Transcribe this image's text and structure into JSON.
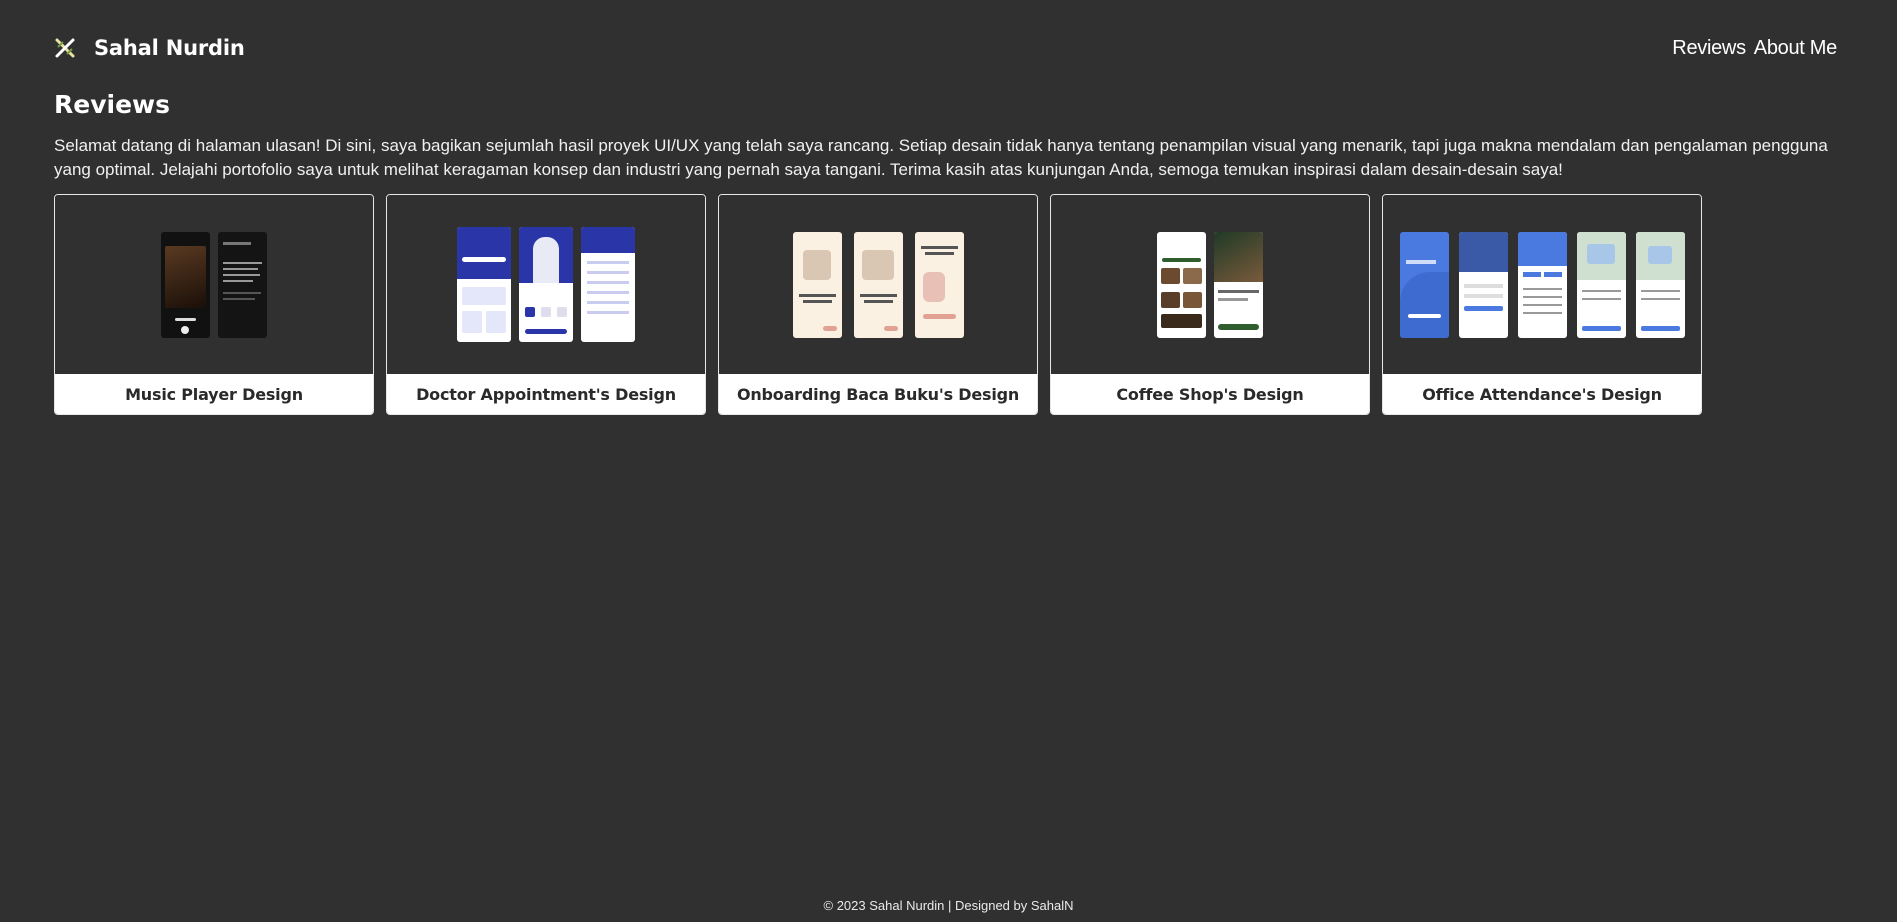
{
  "header": {
    "brand_name": "Sahal Nurdin",
    "logo_icon": "crossed-swords-logo-icon",
    "nav": [
      {
        "label": "Reviews"
      },
      {
        "label": "About Me"
      }
    ]
  },
  "page": {
    "title": "Reviews",
    "intro": "Selamat datang di halaman ulasan! Di sini, saya bagikan sejumlah hasil proyek UI/UX yang telah saya rancang. Setiap desain tidak hanya tentang penampilan visual yang menarik, tapi juga makna mendalam dan pengalaman pengguna yang optimal. Jelajahi portofolio saya untuk melihat keragaman konsep dan industri yang pernah saya tangani. Terima kasih atas kunjungan Anda, semoga temukan inspirasi dalam desain-desain saya!"
  },
  "cards": [
    {
      "title": "Music Player Design"
    },
    {
      "title": "Doctor Appointment's Design"
    },
    {
      "title": "Onboarding Baca Buku's Design"
    },
    {
      "title": "Coffee Shop's Design"
    },
    {
      "title": "Office Attendance's Design"
    }
  ],
  "colors": {
    "background": "#303030",
    "card_label_bg": "#ffffff",
    "doctor_blue": "#2a35a8",
    "attendance_blue": "#4a7ae0",
    "coffee_green": "#2f5d2f",
    "onboarding_cream": "#fbf1e2"
  },
  "footer": {
    "text": "© 2023 Sahal Nurdin | Designed by SahalN"
  }
}
